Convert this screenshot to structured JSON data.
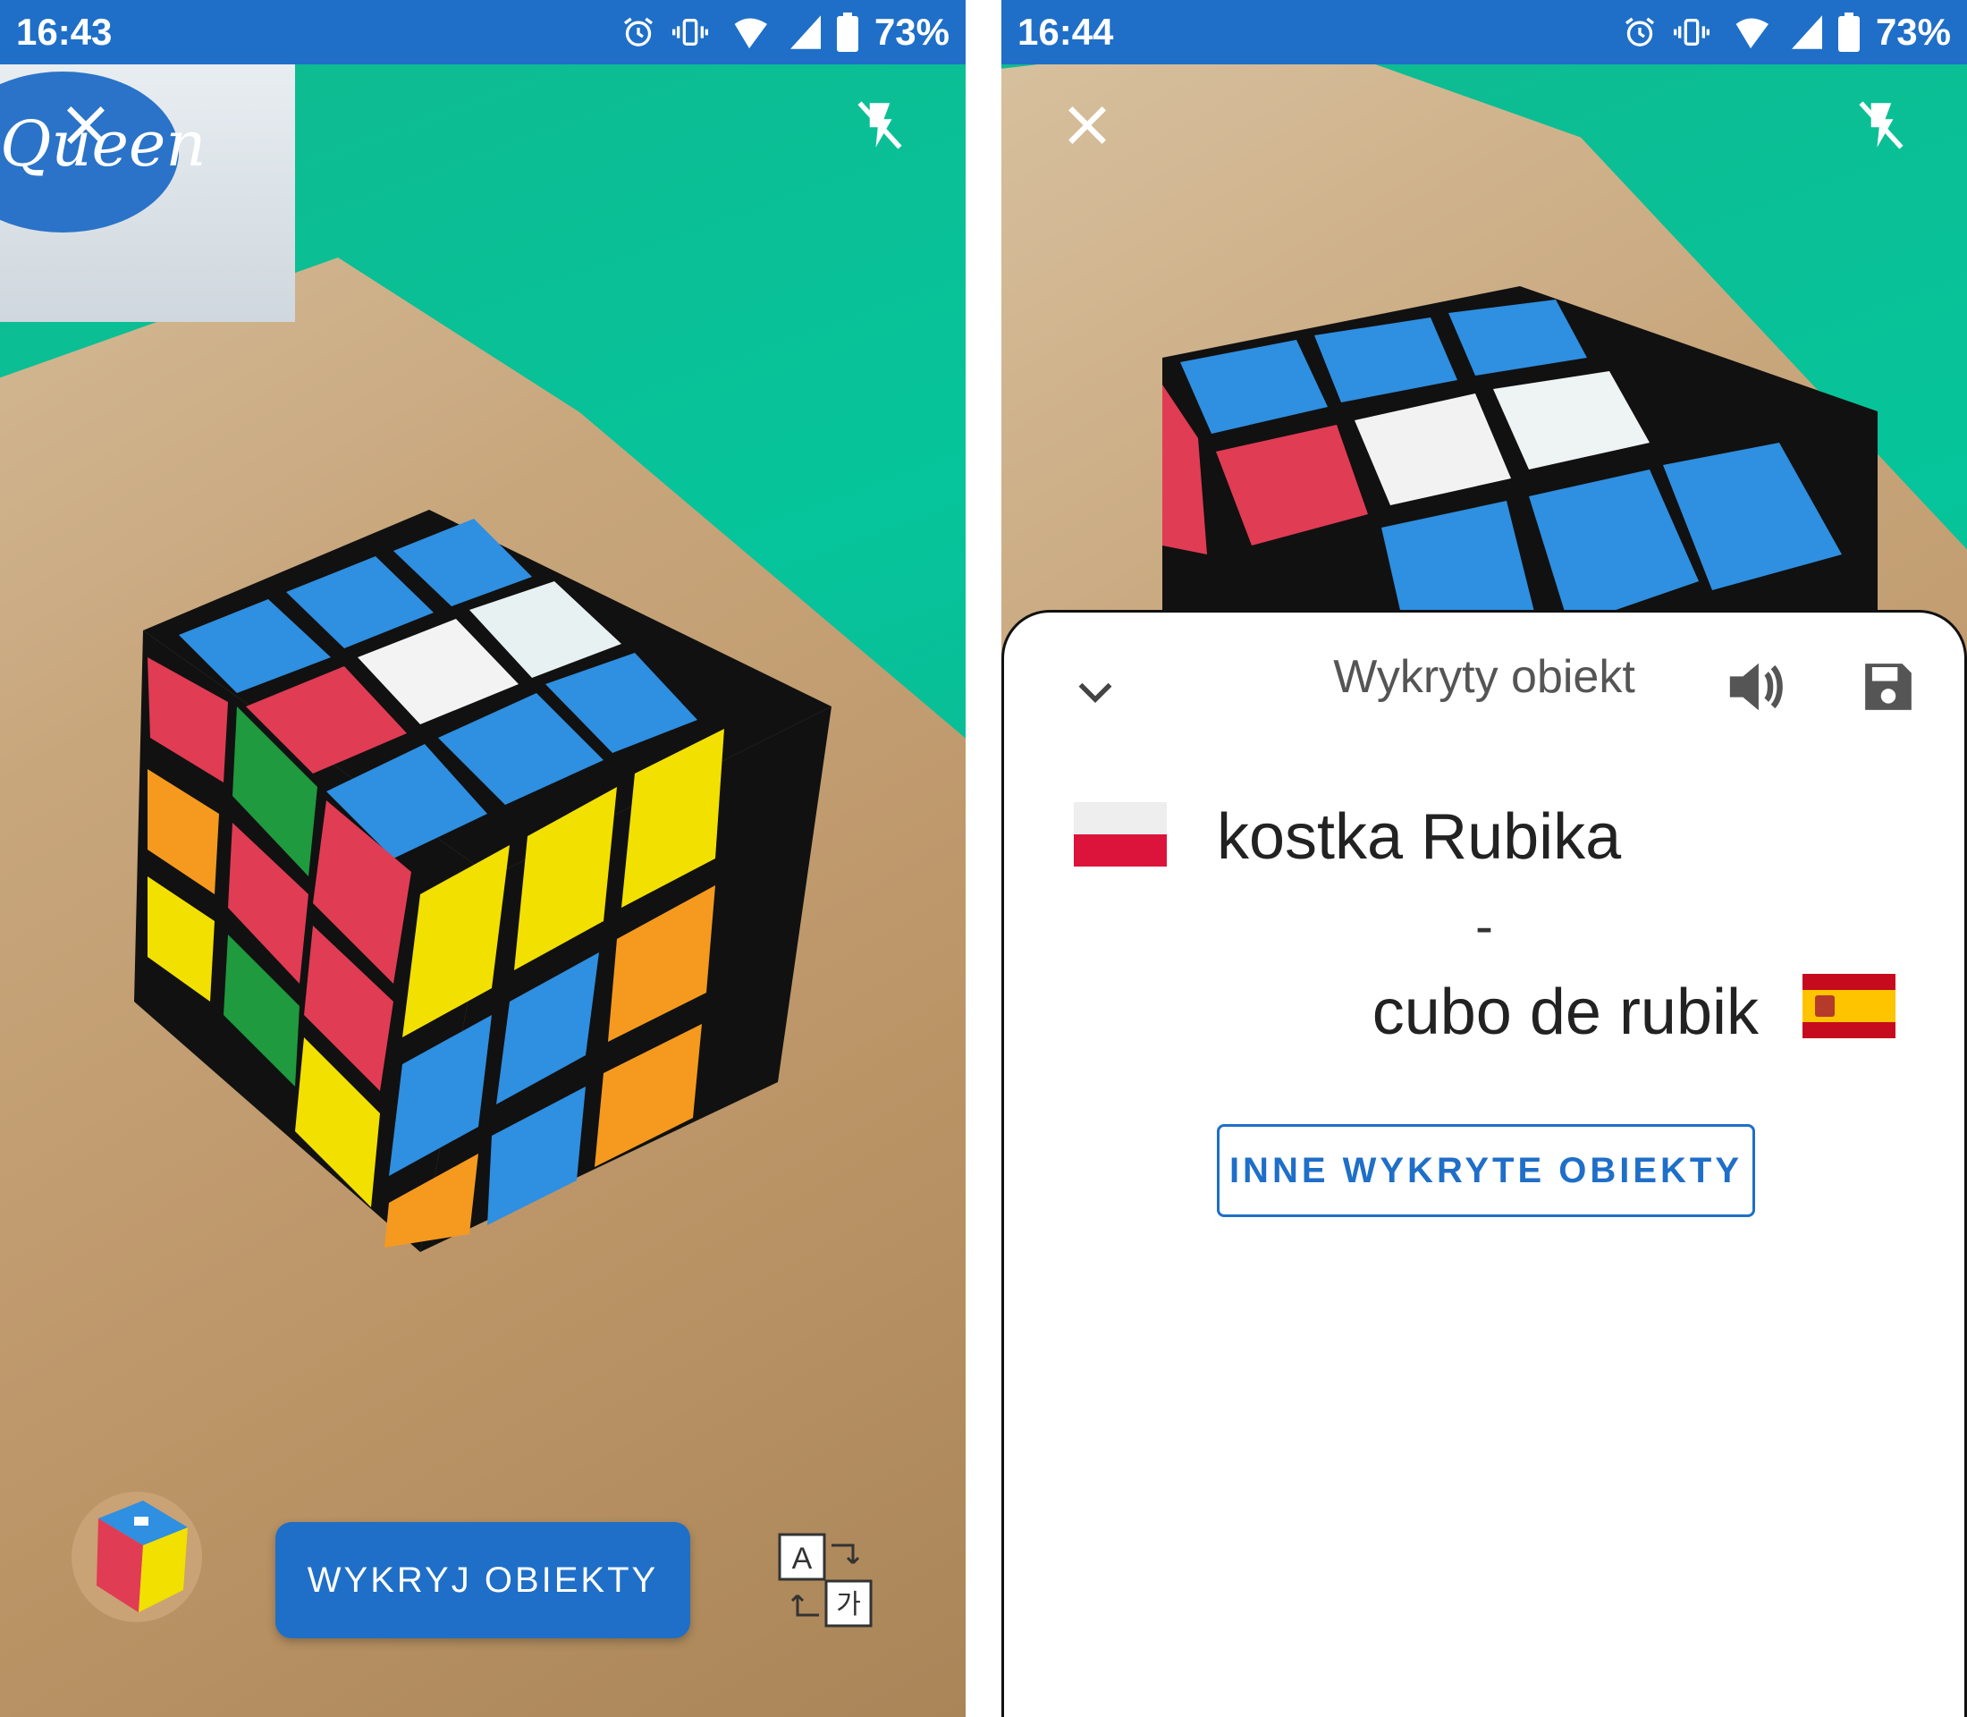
{
  "left_screen": {
    "status_bar": {
      "time": "16:43",
      "battery": "73%"
    },
    "box_brand": "Queen",
    "detect_button_label": "WYKRYJ OBIEKTY"
  },
  "right_screen": {
    "status_bar": {
      "time": "16:44",
      "battery": "73%"
    },
    "sheet": {
      "title": "Wykryty obiekt",
      "source_word": "kostka Rubika",
      "separator": "-",
      "target_word": "cubo de rubik",
      "other_objects_button": "INNE WYKRYTE OBIEKTY"
    }
  },
  "icons": {
    "close": "close-icon",
    "flash_off": "flash-off-icon",
    "alarm": "alarm-icon",
    "vibrate": "vibrate-icon",
    "wifi": "wifi-icon",
    "signal": "signal-icon",
    "battery": "battery-icon",
    "chevron_down": "chevron-down-icon",
    "speaker": "speaker-icon",
    "save": "save-icon",
    "translate": "translate-icon"
  },
  "colors": {
    "primary": "#1f6fc8",
    "sheet_background": "#ffffff",
    "title_text": "#555555"
  }
}
